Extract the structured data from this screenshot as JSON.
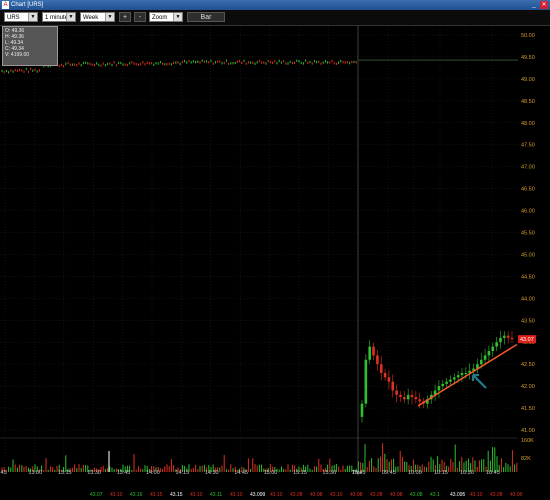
{
  "window": {
    "title": "Chart [URS]",
    "icon": "app-a-icon",
    "min": "_",
    "close": "✕"
  },
  "toolbar": {
    "symbol": "URS",
    "interval": "1 minute",
    "range": "Week",
    "plus": "+",
    "minus": "-",
    "zoom": "Zoom",
    "bar": "Bar"
  },
  "infobox": {
    "header": "",
    "open": "O: 49.36",
    "high": "H: 49.36",
    "low": "L: 49.34",
    "close": "C: 49.34",
    "volume": "V: 4199.00"
  },
  "colors": {
    "price_axis": "#d4a02a",
    "up": "#30c030",
    "down": "#e03020",
    "trend": "#ff5a2a",
    "crosshair": "#aaaaaa",
    "arrow": "#1e7a8c",
    "last_tag": "#e0201a"
  },
  "chart_data": {
    "type": "candlestick",
    "price_axis_ticks": [
      "50.00",
      "49.50",
      "49.00",
      "48.50",
      "48.00",
      "47.50",
      "47.00",
      "46.50",
      "46.00",
      "45.50",
      "45.00",
      "44.50",
      "44.00",
      "43.50",
      "43.00",
      "42.50",
      "42.00",
      "41.50",
      "41.00"
    ],
    "volume_axis_ticks": [
      "160K",
      "82K"
    ],
    "time_ticks": [
      ":45",
      "13:00",
      "13:15",
      "13:30",
      "13:45",
      "14:00",
      "14:15",
      "14:30",
      "14:45",
      "15:00",
      "15:15",
      "15:30",
      "15:45",
      "Thu",
      "09:45",
      "10:00",
      "10:15",
      "10:30",
      "10:45"
    ],
    "ylim": [
      41.0,
      50.0
    ],
    "last_price": "43.07",
    "crosshair_price": 49.43,
    "trendline": [
      [
        41.55,
        "10:00"
      ],
      [
        42.95,
        "10:47"
      ]
    ],
    "prior_session_price": 49.3,
    "session_two_prices": [
      41.6,
      42.6,
      42.9,
      42.7,
      42.5,
      42.3,
      42.2,
      42.1,
      41.9,
      41.8,
      41.75,
      41.7,
      41.8,
      41.75,
      41.7,
      41.65,
      41.6,
      41.7,
      41.8,
      41.9,
      42.0,
      42.05,
      42.1,
      42.15,
      42.2,
      42.25,
      42.3,
      42.3,
      42.35,
      42.4,
      42.5,
      42.6,
      42.7,
      42.8,
      42.9,
      43.0,
      43.1,
      43.15,
      43.1,
      43.07
    ],
    "ticker_values": [
      {
        "v": "43.07",
        "c": "#30c030"
      },
      {
        "v": "43.10",
        "c": "#e03020"
      },
      {
        "v": "43.16",
        "c": "#30c030"
      },
      {
        "v": "43.15",
        "c": "#e03020"
      },
      {
        "v": "43.15",
        "c": "#ffffff"
      },
      {
        "v": "43.10",
        "c": "#e03020"
      },
      {
        "v": "43.11",
        "c": "#30c030"
      },
      {
        "v": "43.10",
        "c": "#e03020"
      },
      {
        "v": "43.099",
        "c": "#ffffff"
      },
      {
        "v": "43.10",
        "c": "#e03020"
      },
      {
        "v": "43.08",
        "c": "#e03020"
      },
      {
        "v": "43.08",
        "c": "#e03020"
      },
      {
        "v": "43.10",
        "c": "#e03020"
      },
      {
        "v": "43.08",
        "c": "#e03020"
      },
      {
        "v": "43.08",
        "c": "#e03020"
      },
      {
        "v": "43.08",
        "c": "#e03020"
      },
      {
        "v": "43.08",
        "c": "#30c030"
      },
      {
        "v": "43.1",
        "c": "#30c030"
      },
      {
        "v": "43.095",
        "c": "#ffffff"
      },
      {
        "v": "43.10",
        "c": "#e03020"
      },
      {
        "v": "43.08",
        "c": "#e03020"
      },
      {
        "v": "43.09",
        "c": "#e03020"
      }
    ]
  }
}
